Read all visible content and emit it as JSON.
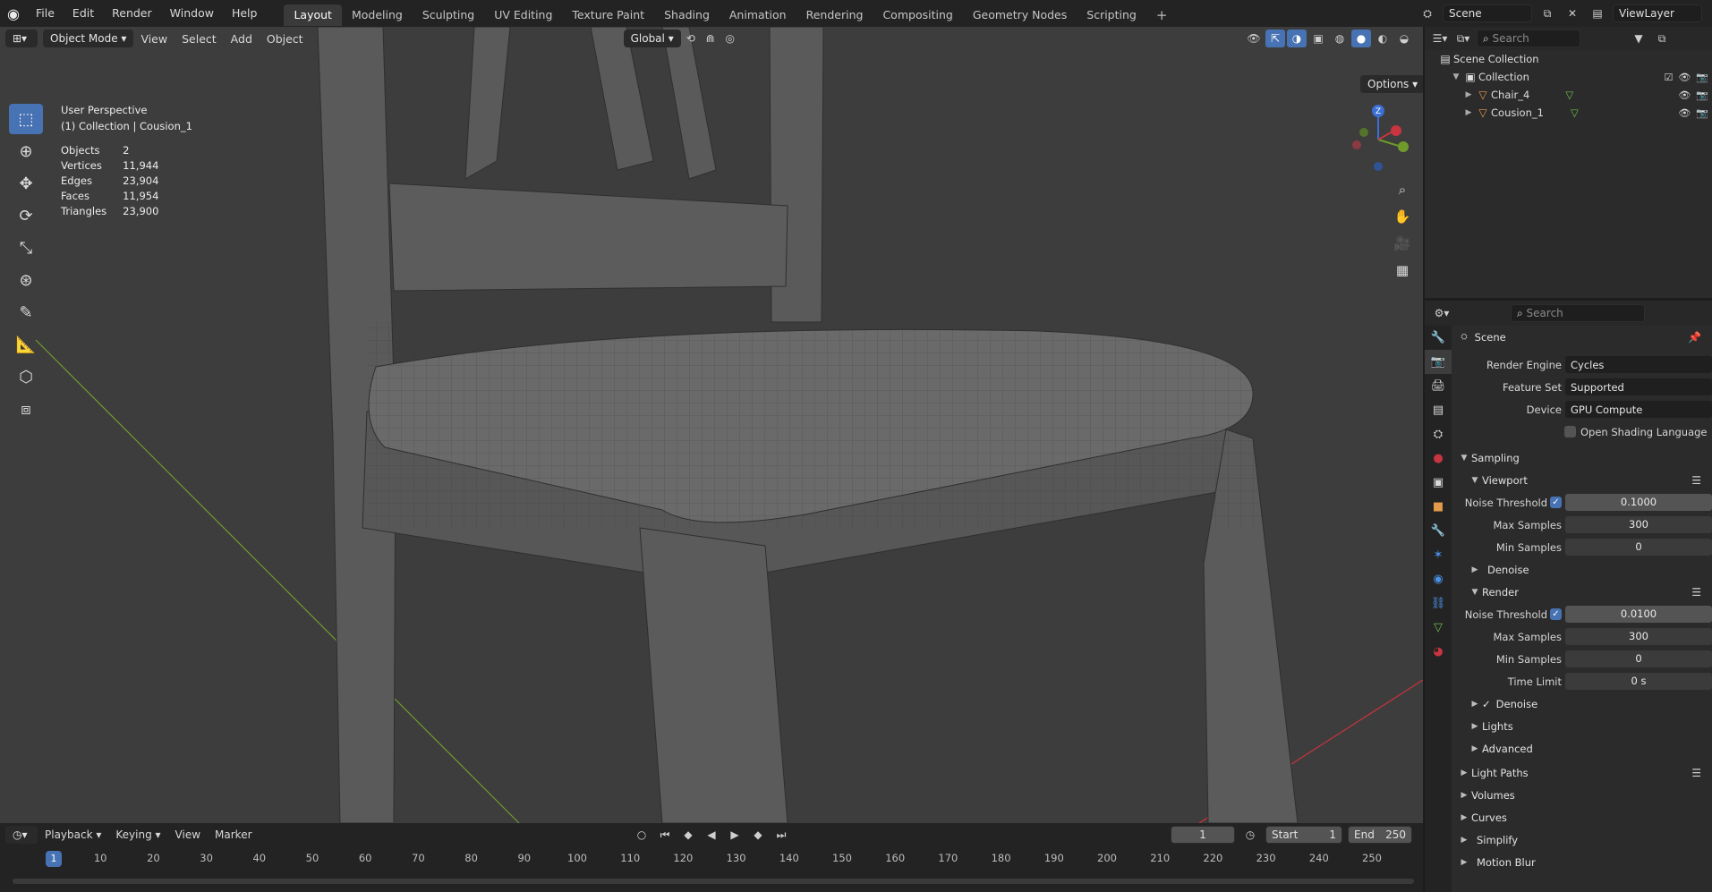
{
  "topbar": {
    "menus": [
      "File",
      "Edit",
      "Render",
      "Window",
      "Help"
    ],
    "workspaces": [
      "Layout",
      "Modeling",
      "Sculpting",
      "UV Editing",
      "Texture Paint",
      "Shading",
      "Animation",
      "Rendering",
      "Compositing",
      "Geometry Nodes",
      "Scripting"
    ],
    "active_workspace": "Layout",
    "scene_name": "Scene",
    "view_layer": "ViewLayer"
  },
  "viewport": {
    "mode": "Object Mode",
    "menus": [
      "View",
      "Select",
      "Add",
      "Object"
    ],
    "orientation": "Global",
    "options_label": "Options",
    "perspective": "User Perspective",
    "collection_path": "(1) Collection | Cousion_1",
    "stats": [
      {
        "label": "Objects",
        "value": "2"
      },
      {
        "label": "Vertices",
        "value": "11,944"
      },
      {
        "label": "Edges",
        "value": "23,904"
      },
      {
        "label": "Faces",
        "value": "11,954"
      },
      {
        "label": "Triangles",
        "value": "23,900"
      }
    ],
    "gizmo_axis": "Z"
  },
  "timeline": {
    "menus": [
      "Playback",
      "Keying",
      "View",
      "Marker"
    ],
    "current_frame": "1",
    "start_label": "Start",
    "start": "1",
    "end_label": "End",
    "end": "250",
    "ruler": [
      "10",
      "20",
      "30",
      "40",
      "50",
      "60",
      "70",
      "80",
      "90",
      "100",
      "110",
      "120",
      "130",
      "140",
      "150",
      "160",
      "170",
      "180",
      "190",
      "200",
      "210",
      "220",
      "230",
      "240",
      "250"
    ]
  },
  "outliner": {
    "search_placeholder": "Search",
    "scene_collection": "Scene Collection",
    "collection": "Collection",
    "objects": [
      "Chair_4",
      "Cousion_1"
    ]
  },
  "properties": {
    "search_placeholder": "Search",
    "context": "Scene",
    "render_engine_label": "Render Engine",
    "render_engine": "Cycles",
    "feature_set_label": "Feature Set",
    "feature_set": "Supported",
    "device_label": "Device",
    "device": "GPU Compute",
    "osl_label": "Open Shading Language",
    "sampling": "Sampling",
    "viewport": "Viewport",
    "noise_threshold_label": "Noise Threshold",
    "vp_noise_threshold": "0.1000",
    "max_samples_label": "Max Samples",
    "vp_max_samples": "300",
    "min_samples_label": "Min Samples",
    "vp_min_samples": "0",
    "denoise_label": "Denoise",
    "render": "Render",
    "r_noise_threshold": "0.0100",
    "r_max_samples": "300",
    "r_min_samples": "0",
    "time_limit_label": "Time Limit",
    "r_time_limit": "0 s",
    "lights": "Lights",
    "advanced": "Advanced",
    "light_paths": "Light Paths",
    "volumes": "Volumes",
    "curves": "Curves",
    "simplify": "Simplify",
    "motion_blur": "Motion Blur"
  },
  "colors": {
    "accent": "#4772b3",
    "viewport_bg": "#3d3d3d",
    "panel_bg": "#2b2b2b",
    "x_axis": "#c8343f",
    "y_axis": "#6e9b2c",
    "z_axis": "#3b6fd6"
  }
}
